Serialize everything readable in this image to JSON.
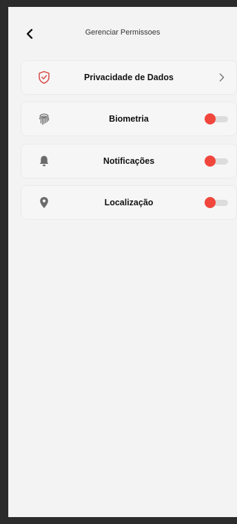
{
  "header": {
    "title": "Gerenciar Permissoes",
    "back_icon": "back-arrow-icon"
  },
  "colors": {
    "accent": "#f1463c",
    "shield": "#d9534f",
    "icon_gray": "#6b6b6b",
    "background": "#f3f3f3"
  },
  "items": [
    {
      "label": "Privacidade de Dados",
      "icon": "shield-check-icon",
      "action": "chevron-right-icon"
    },
    {
      "label": "Biometria",
      "icon": "fingerprint-icon",
      "toggle_on": false
    },
    {
      "label": "Notificações",
      "icon": "bell-icon",
      "toggle_on": false
    },
    {
      "label": "Localização",
      "icon": "location-pin-icon",
      "toggle_on": false
    }
  ]
}
